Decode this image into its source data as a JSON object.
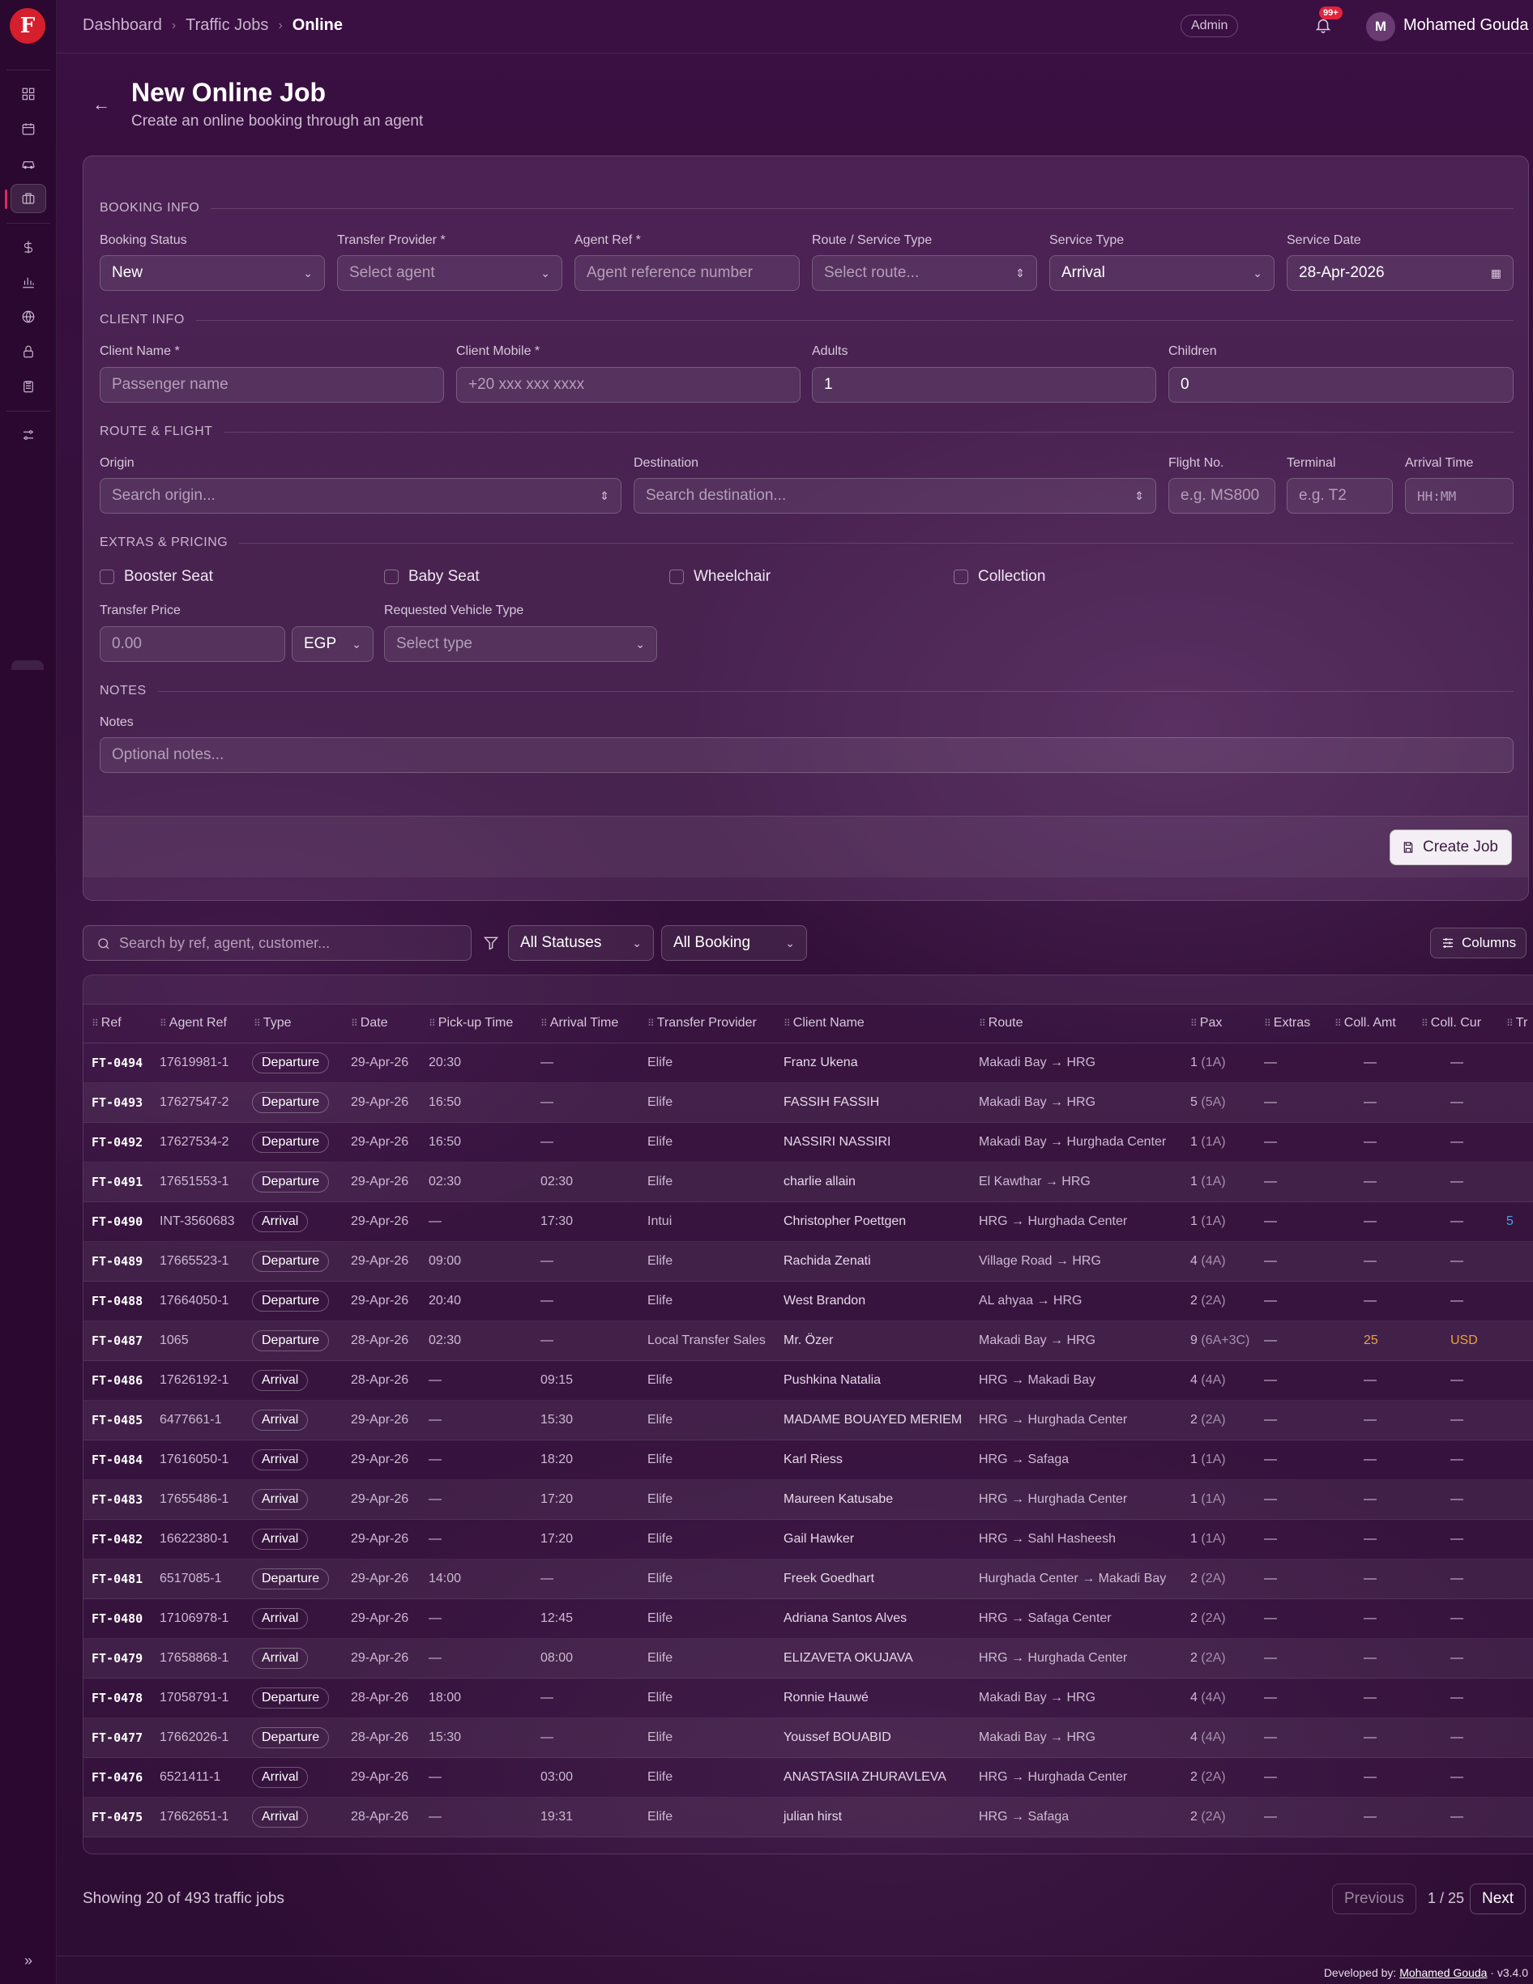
{
  "app": {
    "logo_letter": "F",
    "brand_color": "#d61f2c"
  },
  "breadcrumb": [
    "Dashboard",
    "Traffic Jobs",
    "Online"
  ],
  "header": {
    "role_badge": "Admin",
    "notifications": "99+",
    "avatar_initial": "M",
    "user_name": "Mohamed Gouda"
  },
  "page": {
    "title": "New Online Job",
    "subtitle": "Create an online booking through an agent"
  },
  "form": {
    "booking_info": {
      "heading": "BOOKING INFO",
      "booking_status": {
        "label": "Booking Status",
        "value": "New"
      },
      "transfer_provider": {
        "label": "Transfer Provider *",
        "placeholder": "Select agent"
      },
      "agent_ref": {
        "label": "Agent Ref *",
        "placeholder": "Agent reference number"
      },
      "route": {
        "label": "Route / Service Type",
        "placeholder": "Select route..."
      },
      "service_type": {
        "label": "Service Type",
        "value": "Arrival"
      },
      "service_date": {
        "label": "Service Date",
        "value": "28-Apr-2026"
      }
    },
    "client_info": {
      "heading": "CLIENT INFO",
      "client_name": {
        "label": "Client Name *",
        "placeholder": "Passenger name"
      },
      "client_mobile": {
        "label": "Client Mobile *",
        "placeholder": "+20 xxx xxx xxxx"
      },
      "adults": {
        "label": "Adults",
        "value": "1"
      },
      "children": {
        "label": "Children",
        "value": "0"
      }
    },
    "route_flight": {
      "heading": "ROUTE & FLIGHT",
      "origin": {
        "label": "Origin",
        "placeholder": "Search origin..."
      },
      "destination": {
        "label": "Destination",
        "placeholder": "Search destination..."
      },
      "flight_no": {
        "label": "Flight No.",
        "placeholder": "e.g. MS800"
      },
      "terminal": {
        "label": "Terminal",
        "placeholder": "e.g. T2"
      },
      "arrival_time": {
        "label": "Arrival Time",
        "placeholder": "HH:MM"
      }
    },
    "extras": {
      "heading": "EXTRAS & PRICING",
      "booster_seat": "Booster Seat",
      "baby_seat": "Baby Seat",
      "wheelchair": "Wheelchair",
      "collection": "Collection",
      "transfer_price": {
        "label": "Transfer Price",
        "placeholder": "0.00"
      },
      "currency": "EGP",
      "vehicle_type": {
        "label": "Requested Vehicle Type",
        "placeholder": "Select type"
      }
    },
    "notes": {
      "heading": "NOTES",
      "label": "Notes",
      "placeholder": "Optional notes..."
    },
    "create_button": "Create Job"
  },
  "toolbar": {
    "search_placeholder": "Search by ref, agent, customer...",
    "status_filter": "All Statuses",
    "booking_filter": "All Booking",
    "columns_button": "Columns"
  },
  "table": {
    "columns": [
      "Ref",
      "Agent Ref",
      "Type",
      "Date",
      "Pick-up Time",
      "Arrival Time",
      "Transfer Provider",
      "Client Name",
      "Route",
      "Pax",
      "Extras",
      "Coll. Amt",
      "Coll. Cur",
      "Tr"
    ],
    "rows": [
      {
        "ref": "FT-0494",
        "agent_ref": "17619981-1",
        "type": "Departure",
        "date": "29-Apr-26",
        "pickup": "20:30",
        "arrival": "—",
        "provider": "Elife",
        "client": "Franz Ukena",
        "route": "Makadi Bay → HRG",
        "pax": "1",
        "pax_sub": "(1A)",
        "extras": "—",
        "coll_amt": "—",
        "coll_cur": "—"
      },
      {
        "ref": "FT-0493",
        "agent_ref": "17627547-2",
        "type": "Departure",
        "date": "29-Apr-26",
        "pickup": "16:50",
        "arrival": "—",
        "provider": "Elife",
        "client": "FASSIH FASSIH",
        "route": "Makadi Bay → HRG",
        "pax": "5",
        "pax_sub": "(5A)",
        "extras": "—",
        "coll_amt": "—",
        "coll_cur": "—"
      },
      {
        "ref": "FT-0492",
        "agent_ref": "17627534-2",
        "type": "Departure",
        "date": "29-Apr-26",
        "pickup": "16:50",
        "arrival": "—",
        "provider": "Elife",
        "client": "NASSIRI NASSIRI",
        "route": "Makadi Bay → Hurghada Center",
        "pax": "1",
        "pax_sub": "(1A)",
        "extras": "—",
        "coll_amt": "—",
        "coll_cur": "—"
      },
      {
        "ref": "FT-0491",
        "agent_ref": "17651553-1",
        "type": "Departure",
        "date": "29-Apr-26",
        "pickup": "02:30",
        "arrival": "02:30",
        "provider": "Elife",
        "client": "charlie allain",
        "route": "El Kawthar → HRG",
        "pax": "1",
        "pax_sub": "(1A)",
        "extras": "—",
        "coll_amt": "—",
        "coll_cur": "—"
      },
      {
        "ref": "FT-0490",
        "agent_ref": "INT-3560683",
        "type": "Arrival",
        "date": "29-Apr-26",
        "pickup": "—",
        "arrival": "17:30",
        "provider": "Intui",
        "client": "Christopher Poettgen",
        "route": "HRG → Hurghada Center",
        "pax": "1",
        "pax_sub": "(1A)",
        "extras": "—",
        "coll_amt": "—",
        "coll_cur": "—",
        "tr": "5"
      },
      {
        "ref": "FT-0489",
        "agent_ref": "17665523-1",
        "type": "Departure",
        "date": "29-Apr-26",
        "pickup": "09:00",
        "arrival": "—",
        "provider": "Elife",
        "client": "Rachida Zenati",
        "route": "Village Road → HRG",
        "pax": "4",
        "pax_sub": "(4A)",
        "extras": "—",
        "coll_amt": "—",
        "coll_cur": "—"
      },
      {
        "ref": "FT-0488",
        "agent_ref": "17664050-1",
        "type": "Departure",
        "date": "29-Apr-26",
        "pickup": "20:40",
        "arrival": "—",
        "provider": "Elife",
        "client": "West Brandon",
        "route": "AL ahyaa → HRG",
        "pax": "2",
        "pax_sub": "(2A)",
        "extras": "—",
        "coll_amt": "—",
        "coll_cur": "—"
      },
      {
        "ref": "FT-0487",
        "agent_ref": "1065",
        "type": "Departure",
        "date": "28-Apr-26",
        "pickup": "02:30",
        "arrival": "—",
        "provider": "Local Transfer Sales",
        "client": "Mr. Özer",
        "route": "Makadi Bay → HRG",
        "pax": "9",
        "pax_sub": "(6A+3C)",
        "extras": "—",
        "coll_amt": "25",
        "coll_cur": "USD",
        "highlight": true
      },
      {
        "ref": "FT-0486",
        "agent_ref": "17626192-1",
        "type": "Arrival",
        "date": "28-Apr-26",
        "pickup": "—",
        "arrival": "09:15",
        "provider": "Elife",
        "client": "Pushkina Natalia",
        "route": "HRG → Makadi Bay",
        "pax": "4",
        "pax_sub": "(4A)",
        "extras": "—",
        "coll_amt": "—",
        "coll_cur": "—"
      },
      {
        "ref": "FT-0485",
        "agent_ref": "6477661-1",
        "type": "Arrival",
        "date": "29-Apr-26",
        "pickup": "—",
        "arrival": "15:30",
        "provider": "Elife",
        "client": "MADAME BOUAYED MERIEM",
        "route": "HRG → Hurghada Center",
        "pax": "2",
        "pax_sub": "(2A)",
        "extras": "—",
        "coll_amt": "—",
        "coll_cur": "—"
      },
      {
        "ref": "FT-0484",
        "agent_ref": "17616050-1",
        "type": "Arrival",
        "date": "29-Apr-26",
        "pickup": "—",
        "arrival": "18:20",
        "provider": "Elife",
        "client": "Karl Riess",
        "route": "HRG → Safaga",
        "pax": "1",
        "pax_sub": "(1A)",
        "extras": "—",
        "coll_amt": "—",
        "coll_cur": "—"
      },
      {
        "ref": "FT-0483",
        "agent_ref": "17655486-1",
        "type": "Arrival",
        "date": "29-Apr-26",
        "pickup": "—",
        "arrival": "17:20",
        "provider": "Elife",
        "client": "Maureen Katusabe",
        "route": "HRG → Hurghada Center",
        "pax": "1",
        "pax_sub": "(1A)",
        "extras": "—",
        "coll_amt": "—",
        "coll_cur": "—"
      },
      {
        "ref": "FT-0482",
        "agent_ref": "16622380-1",
        "type": "Arrival",
        "date": "29-Apr-26",
        "pickup": "—",
        "arrival": "17:20",
        "provider": "Elife",
        "client": "Gail Hawker",
        "route": "HRG → Sahl Hasheesh",
        "pax": "1",
        "pax_sub": "(1A)",
        "extras": "—",
        "coll_amt": "—",
        "coll_cur": "—"
      },
      {
        "ref": "FT-0481",
        "agent_ref": "6517085-1",
        "type": "Departure",
        "date": "29-Apr-26",
        "pickup": "14:00",
        "arrival": "—",
        "provider": "Elife",
        "client": "Freek Goedhart",
        "route": "Hurghada Center → Makadi Bay",
        "pax": "2",
        "pax_sub": "(2A)",
        "extras": "—",
        "coll_amt": "—",
        "coll_cur": "—"
      },
      {
        "ref": "FT-0480",
        "agent_ref": "17106978-1",
        "type": "Arrival",
        "date": "29-Apr-26",
        "pickup": "—",
        "arrival": "12:45",
        "provider": "Elife",
        "client": "Adriana Santos Alves",
        "route": "HRG → Safaga Center",
        "pax": "2",
        "pax_sub": "(2A)",
        "extras": "—",
        "coll_amt": "—",
        "coll_cur": "—"
      },
      {
        "ref": "FT-0479",
        "agent_ref": "17658868-1",
        "type": "Arrival",
        "date": "29-Apr-26",
        "pickup": "—",
        "arrival": "08:00",
        "provider": "Elife",
        "client": "ELIZAVETA OKUJAVA",
        "route": "HRG → Hurghada Center",
        "pax": "2",
        "pax_sub": "(2A)",
        "extras": "—",
        "coll_amt": "—",
        "coll_cur": "—"
      },
      {
        "ref": "FT-0478",
        "agent_ref": "17058791-1",
        "type": "Departure",
        "date": "28-Apr-26",
        "pickup": "18:00",
        "arrival": "—",
        "provider": "Elife",
        "client": "Ronnie Hauwé",
        "route": "Makadi Bay → HRG",
        "pax": "4",
        "pax_sub": "(4A)",
        "extras": "—",
        "coll_amt": "—",
        "coll_cur": "—"
      },
      {
        "ref": "FT-0477",
        "agent_ref": "17662026-1",
        "type": "Departure",
        "date": "28-Apr-26",
        "pickup": "15:30",
        "arrival": "—",
        "provider": "Elife",
        "client": "Youssef BOUABID",
        "route": "Makadi Bay → HRG",
        "pax": "4",
        "pax_sub": "(4A)",
        "extras": "—",
        "coll_amt": "—",
        "coll_cur": "—"
      },
      {
        "ref": "FT-0476",
        "agent_ref": "6521411-1",
        "type": "Arrival",
        "date": "29-Apr-26",
        "pickup": "—",
        "arrival": "03:00",
        "provider": "Elife",
        "client": "ANASTASIIA ZHURAVLEVA",
        "route": "HRG → Hurghada Center",
        "pax": "2",
        "pax_sub": "(2A)",
        "extras": "—",
        "coll_amt": "—",
        "coll_cur": "—"
      },
      {
        "ref": "FT-0475",
        "agent_ref": "17662651-1",
        "type": "Arrival",
        "date": "28-Apr-26",
        "pickup": "—",
        "arrival": "19:31",
        "provider": "Elife",
        "client": "julian hirst",
        "route": "HRG → Safaga",
        "pax": "2",
        "pax_sub": "(2A)",
        "extras": "—",
        "coll_amt": "—",
        "coll_cur": "—"
      }
    ]
  },
  "pagination": {
    "showing": "Showing 20 of 493 traffic jobs",
    "previous": "Previous",
    "page": "1 / 25",
    "next": "Next"
  },
  "footer": {
    "prefix": "Developed by:",
    "author": "Mohamed Gouda",
    "version": "· v3.4.0"
  }
}
